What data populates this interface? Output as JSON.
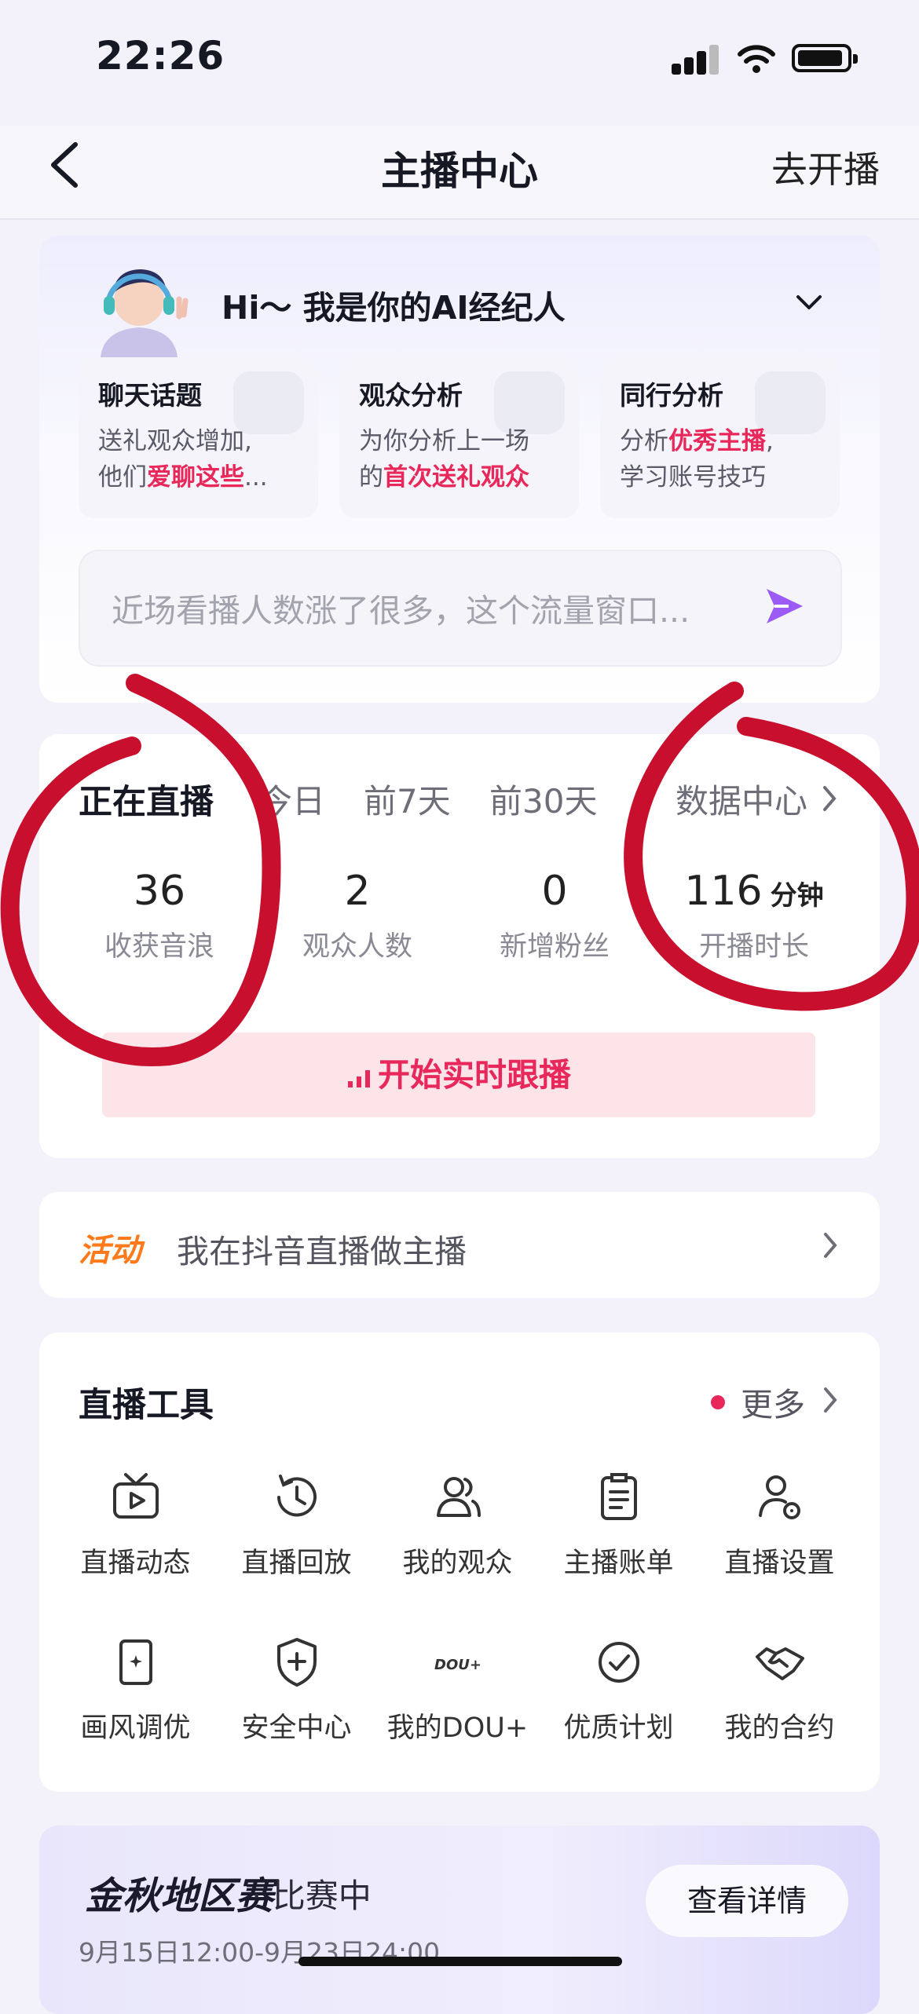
{
  "status_bar": {
    "time": "22:26"
  },
  "nav": {
    "title": "主播中心",
    "right_action": "去开播"
  },
  "ai_agent": {
    "greeting": "Hi～ 我是你的AI经纪人",
    "tiles": [
      {
        "title": "聊天话题",
        "desc_plain": "送礼观众增加,\n他们",
        "desc_highlight": "爱聊这些",
        "desc_tail": "..."
      },
      {
        "title": "观众分析",
        "desc_plain": "为你分析上一场\n的",
        "desc_highlight": "首次送礼观众",
        "desc_tail": ""
      },
      {
        "title": "同行分析",
        "desc_plain": "分析",
        "desc_highlight": "优秀主播",
        "desc_tail": ",\n学习账号技巧"
      }
    ],
    "input_placeholder": "近场看播人数涨了很多，这个流量窗口..."
  },
  "stats": {
    "tabs": [
      "正在直播",
      "今日",
      "前7天",
      "前30天"
    ],
    "active_tab": "正在直播",
    "data_center_link": "数据中心",
    "items": [
      {
        "value": "36",
        "unit": "",
        "label": "收获音浪"
      },
      {
        "value": "2",
        "unit": "",
        "label": "观众人数"
      },
      {
        "value": "0",
        "unit": "",
        "label": "新增粉丝"
      },
      {
        "value": "116",
        "unit": "分钟",
        "label": "开播时长"
      }
    ],
    "follow_button": "开始实时跟播"
  },
  "activity": {
    "tag": "活动",
    "text": "我在抖音直播做主播"
  },
  "tools": {
    "title": "直播工具",
    "more": "更多",
    "items": [
      {
        "label": "直播动态",
        "icon": "tv-icon"
      },
      {
        "label": "直播回放",
        "icon": "history-icon"
      },
      {
        "label": "我的观众",
        "icon": "audience-icon"
      },
      {
        "label": "主播账单",
        "icon": "bill-icon"
      },
      {
        "label": "直播设置",
        "icon": "user-settings-icon"
      },
      {
        "label": "画风调优",
        "icon": "image-tune-icon"
      },
      {
        "label": "安全中心",
        "icon": "shield-plus-icon"
      },
      {
        "label": "我的DOU+",
        "icon": "dou-plus-icon"
      },
      {
        "label": "优质计划",
        "icon": "check-circle-icon"
      },
      {
        "label": "我的合约",
        "icon": "handshake-icon"
      }
    ]
  },
  "contest": {
    "title": "金秋地区赛",
    "status": "· 比赛中",
    "dates": "9月15日12:00-9月23日24:00",
    "button": "查看详情"
  },
  "colors": {
    "accent": "#e8275a",
    "activity_tag": "#ff7a1a",
    "send": "#9b5cf6",
    "annotation": "#c8102e"
  }
}
